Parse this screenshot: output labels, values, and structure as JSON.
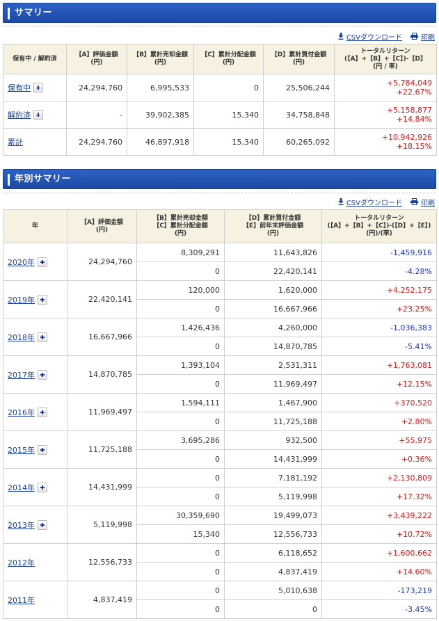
{
  "summary": {
    "title": "サマリー",
    "csv_label": "CSVダウンロード",
    "print_label": "印刷",
    "headers": {
      "status": "保有中 / 解約済",
      "a": [
        "【A】評価金額",
        "(円)"
      ],
      "b": [
        "【B】累計売却金額",
        "(円)"
      ],
      "c": [
        "【C】累計分配金額",
        "(円)"
      ],
      "d": [
        "【D】累計買付金額",
        "(円)"
      ],
      "return": [
        "トータルリターン",
        "(【A】+【B】+【C】)-【D】",
        "(円 / 率)"
      ]
    },
    "rows": [
      {
        "label": "保有中",
        "a": "24,294,760",
        "b": "6,995,533",
        "c": "0",
        "d": "25,506,244",
        "ret": "+5,784,049",
        "rate": "+22.67%"
      },
      {
        "label": "解約済",
        "a": "-",
        "b": "39,902,385",
        "c": "15,340",
        "d": "34,758,848",
        "ret": "+5,158,877",
        "rate": "+14.84%"
      },
      {
        "label": "累計",
        "a": "24,294,760",
        "b": "46,897,918",
        "c": "15,340",
        "d": "60,265,092",
        "ret": "+10,942,926",
        "rate": "+18.15%"
      }
    ]
  },
  "yearly": {
    "title": "年別サマリー",
    "csv_label": "CSVダウンロード",
    "print_label": "印刷",
    "headers": {
      "year": "年",
      "a": [
        "【A】評価金額",
        "(円)"
      ],
      "bc": [
        "【B】累計売却金額",
        "【C】累計分配金額",
        "(円)"
      ],
      "de": [
        "【D】累計買付金額",
        "【E】前年末評価金額",
        "(円)"
      ],
      "return": [
        "トータルリターン",
        "(【A】+【B】+【C】)-(【D】+【E】)",
        "(円)/(率)"
      ]
    },
    "rows": [
      {
        "year": "2020年",
        "plus": true,
        "a": "24,294,760",
        "b": "8,309,291",
        "c": "0",
        "d": "11,643,826",
        "e": "22,420,141",
        "ret": "-1,459,916",
        "rate": "-4.28%"
      },
      {
        "year": "2019年",
        "plus": true,
        "a": "22,420,141",
        "b": "120,000",
        "c": "0",
        "d": "1,620,000",
        "e": "16,667,966",
        "ret": "+4,252,175",
        "rate": "+23.25%"
      },
      {
        "year": "2018年",
        "plus": true,
        "a": "16,667,966",
        "b": "1,426,436",
        "c": "0",
        "d": "4,260,000",
        "e": "14,870,785",
        "ret": "-1,036,383",
        "rate": "-5.41%"
      },
      {
        "year": "2017年",
        "plus": true,
        "a": "14,870,785",
        "b": "1,393,104",
        "c": "0",
        "d": "2,531,311",
        "e": "11,969,497",
        "ret": "+1,763,081",
        "rate": "+12.15%"
      },
      {
        "year": "2016年",
        "plus": true,
        "a": "11,969,497",
        "b": "1,594,111",
        "c": "0",
        "d": "1,467,900",
        "e": "11,725,188",
        "ret": "+370,520",
        "rate": "+2.80%"
      },
      {
        "year": "2015年",
        "plus": true,
        "a": "11,725,188",
        "b": "3,695,286",
        "c": "0",
        "d": "932,500",
        "e": "14,431,999",
        "ret": "+55,975",
        "rate": "+0.36%"
      },
      {
        "year": "2014年",
        "plus": true,
        "a": "14,431,999",
        "b": "0",
        "c": "0",
        "d": "7,181,192",
        "e": "5,119,998",
        "ret": "+2,130,809",
        "rate": "+17.32%"
      },
      {
        "year": "2013年",
        "plus": true,
        "a": "5,119,998",
        "b": "30,359,690",
        "c": "15,340",
        "d": "19,499,073",
        "e": "12,556,733",
        "ret": "+3,439,222",
        "rate": "+10.72%"
      },
      {
        "year": "2012年",
        "plus": false,
        "a": "12,556,733",
        "b": "0",
        "c": "0",
        "d": "6,118,652",
        "e": "4,837,419",
        "ret": "+1,600,662",
        "rate": "+14.60%"
      },
      {
        "year": "2011年",
        "plus": false,
        "a": "4,837,419",
        "b": "0",
        "c": "0",
        "d": "5,010,638",
        "e": "0",
        "ret": "-173,219",
        "rate": "-3.45%"
      }
    ]
  },
  "colors": {
    "positive": "#e2171b",
    "negative": "#1f33d6",
    "header_bg": "#f7f1e1",
    "link": "#1a3f9e",
    "section_blue": "#2456b8"
  },
  "icons": {
    "download": "download-icon",
    "print": "print-icon",
    "expand": "plus-icon"
  }
}
